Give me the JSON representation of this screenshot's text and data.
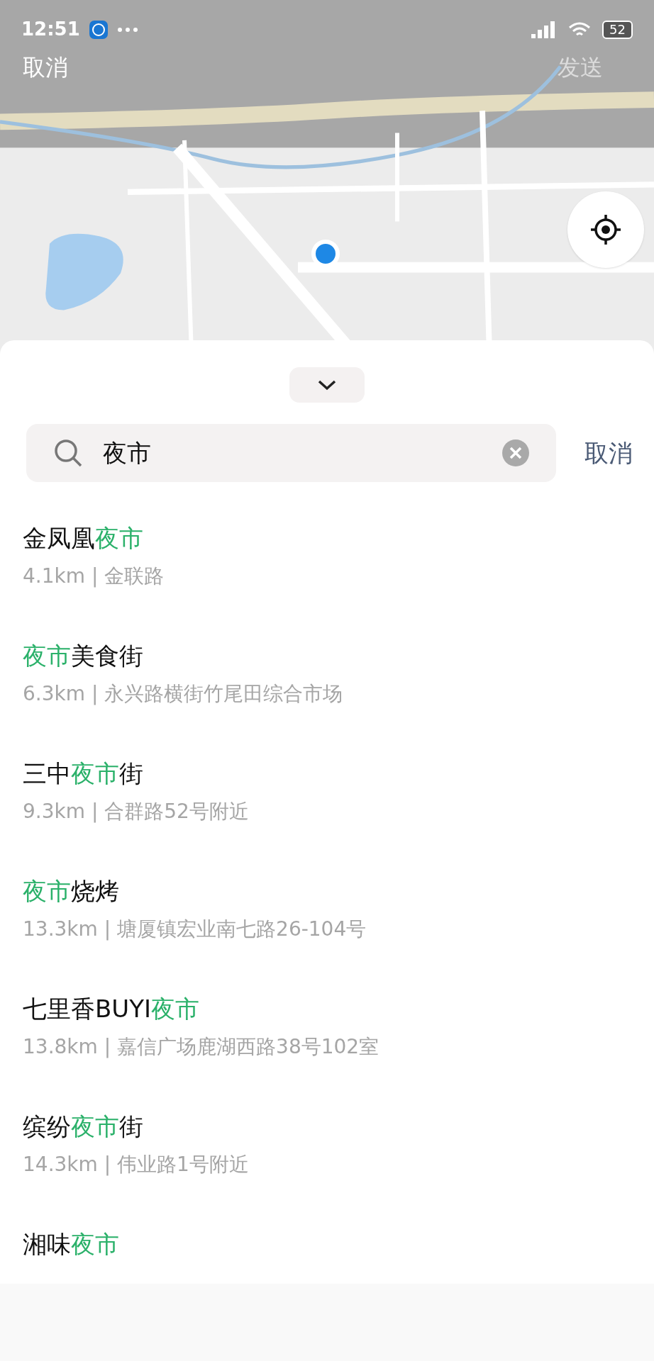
{
  "status_bar": {
    "time": "12:51",
    "battery": "52"
  },
  "map_overlay": {
    "cancel": "取消",
    "send": {
      "label": "发送",
      "disabled": true
    }
  },
  "search": {
    "value": "夜市",
    "cancel": "取消"
  },
  "results": [
    {
      "title": [
        {
          "text": "金凤凰",
          "highlight": false
        },
        {
          "text": "夜市",
          "highlight": true
        }
      ],
      "subtitle": "4.1km | 金联路"
    },
    {
      "title": [
        {
          "text": "夜市",
          "highlight": true
        },
        {
          "text": "美食街",
          "highlight": false
        }
      ],
      "subtitle": "6.3km | 永兴路横街竹尾田综合市场"
    },
    {
      "title": [
        {
          "text": "三中",
          "highlight": false
        },
        {
          "text": "夜市",
          "highlight": true
        },
        {
          "text": "街",
          "highlight": false
        }
      ],
      "subtitle": "9.3km | 合群路52号附近"
    },
    {
      "title": [
        {
          "text": "夜市",
          "highlight": true
        },
        {
          "text": "烧烤",
          "highlight": false
        }
      ],
      "subtitle": "13.3km | 塘厦镇宏业南七路26-104号"
    },
    {
      "title": [
        {
          "text": "七里香BUYI",
          "highlight": false
        },
        {
          "text": "夜市",
          "highlight": true
        }
      ],
      "subtitle": "13.8km | 嘉信广场鹿湖西路38号102室"
    },
    {
      "title": [
        {
          "text": "缤纷",
          "highlight": false
        },
        {
          "text": "夜市",
          "highlight": true
        },
        {
          "text": "街",
          "highlight": false
        }
      ],
      "subtitle": "14.3km | 伟业路1号附近"
    },
    {
      "title": [
        {
          "text": "湘味",
          "highlight": false
        },
        {
          "text": "夜市",
          "highlight": true
        }
      ]
    }
  ]
}
